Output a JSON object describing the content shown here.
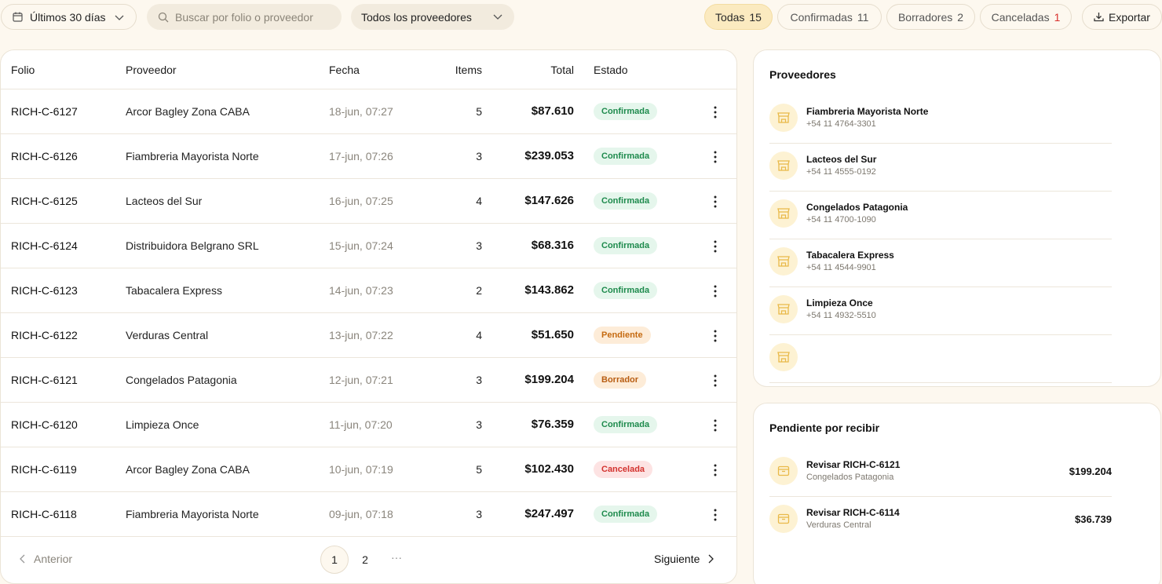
{
  "toolbar": {
    "date_label": "Últimos 30 días",
    "search_placeholder": "Buscar por folio o proveedor",
    "provider_select": "Todos los proveedores",
    "filters": [
      {
        "label": "Todas",
        "count": "15"
      },
      {
        "label": "Confirmadas",
        "count": "11"
      },
      {
        "label": "Borradores",
        "count": "2"
      },
      {
        "label": "Canceladas",
        "count": "1"
      }
    ],
    "export_label": "Exportar"
  },
  "table": {
    "headers": {
      "folio": "Folio",
      "proveedor": "Proveedor",
      "fecha": "Fecha",
      "items": "Items",
      "total": "Total",
      "estado": "Estado"
    },
    "rows": [
      {
        "folio": "RICH-C-6127",
        "proveedor": "Arcor Bagley Zona CABA",
        "fecha": "18-jun, 07:27",
        "items": "5",
        "total": "$87.610",
        "estado": "Confirmada",
        "status": "confirmada"
      },
      {
        "folio": "RICH-C-6126",
        "proveedor": "Fiambreria Mayorista Norte",
        "fecha": "17-jun, 07:26",
        "items": "3",
        "total": "$239.053",
        "estado": "Confirmada",
        "status": "confirmada"
      },
      {
        "folio": "RICH-C-6125",
        "proveedor": "Lacteos del Sur",
        "fecha": "16-jun, 07:25",
        "items": "4",
        "total": "$147.626",
        "estado": "Confirmada",
        "status": "confirmada"
      },
      {
        "folio": "RICH-C-6124",
        "proveedor": "Distribuidora Belgrano SRL",
        "fecha": "15-jun, 07:24",
        "items": "3",
        "total": "$68.316",
        "estado": "Confirmada",
        "status": "confirmada"
      },
      {
        "folio": "RICH-C-6123",
        "proveedor": "Tabacalera Express",
        "fecha": "14-jun, 07:23",
        "items": "2",
        "total": "$143.862",
        "estado": "Confirmada",
        "status": "confirmada"
      },
      {
        "folio": "RICH-C-6122",
        "proveedor": "Verduras Central",
        "fecha": "13-jun, 07:22",
        "items": "4",
        "total": "$51.650",
        "estado": "Pendiente",
        "status": "pendiente"
      },
      {
        "folio": "RICH-C-6121",
        "proveedor": "Congelados Patagonia",
        "fecha": "12-jun, 07:21",
        "items": "3",
        "total": "$199.204",
        "estado": "Borrador",
        "status": "borrador"
      },
      {
        "folio": "RICH-C-6120",
        "proveedor": "Limpieza Once",
        "fecha": "11-jun, 07:20",
        "items": "3",
        "total": "$76.359",
        "estado": "Confirmada",
        "status": "confirmada"
      },
      {
        "folio": "RICH-C-6119",
        "proveedor": "Arcor Bagley Zona CABA",
        "fecha": "10-jun, 07:19",
        "items": "5",
        "total": "$102.430",
        "estado": "Cancelada",
        "status": "cancelada"
      },
      {
        "folio": "RICH-C-6118",
        "proveedor": "Fiambreria Mayorista Norte",
        "fecha": "09-jun, 07:18",
        "items": "3",
        "total": "$247.497",
        "estado": "Confirmada",
        "status": "confirmada"
      }
    ]
  },
  "pagination": {
    "prev_label": "Anterior",
    "pages": [
      "1",
      "2"
    ],
    "ellipsis": "···",
    "next_label": "Siguiente"
  },
  "providers_card": {
    "title": "Proveedores",
    "items": [
      {
        "name": "Fiambreria Mayorista Norte",
        "phone": "+54 11 4764-3301"
      },
      {
        "name": "Lacteos del Sur",
        "phone": "+54 11 4555-0192"
      },
      {
        "name": "Congelados Patagonia",
        "phone": "+54 11 4700-1090"
      },
      {
        "name": "Tabacalera Express",
        "phone": "+54 11 4544-9901"
      },
      {
        "name": "Limpieza Once",
        "phone": "+54 11 4932-5510"
      }
    ]
  },
  "pending_card": {
    "title": "Pendiente por recibir",
    "items": [
      {
        "title": "Revisar RICH-C-6121",
        "provider": "Congelados Patagonia",
        "amount": "$199.204"
      },
      {
        "title": "Revisar RICH-C-6114",
        "provider": "Verduras Central",
        "amount": "$36.739"
      }
    ]
  },
  "colors": {
    "background": "#fdf8ef",
    "accent": "#fbeac0",
    "confirmada": "#1d8a4c",
    "pendiente": "#c56a10",
    "cancelada": "#d3322e",
    "icon": "#f2c94c"
  }
}
